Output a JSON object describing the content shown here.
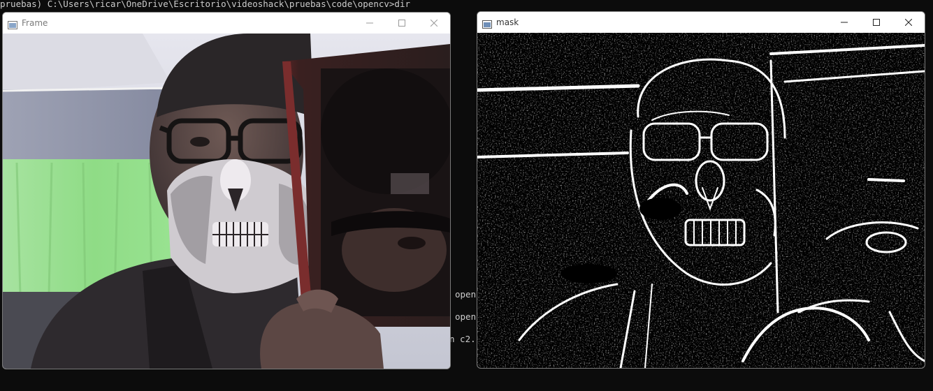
{
  "terminal": {
    "prompt_line": "pruebas) C:\\Users\\ricar\\OneDrive\\Escritorio\\videoshack\\pruebas\\code\\opencv>dir",
    "fragments": [
      "open",
      "open",
      "n c2."
    ]
  },
  "windows": {
    "frame": {
      "title": "Frame"
    },
    "mask": {
      "title": "mask"
    }
  },
  "colors": {
    "terminal_bg": "#0c0c0c",
    "terminal_text": "#cccccc",
    "titlebar_bg": "#ffffff"
  }
}
